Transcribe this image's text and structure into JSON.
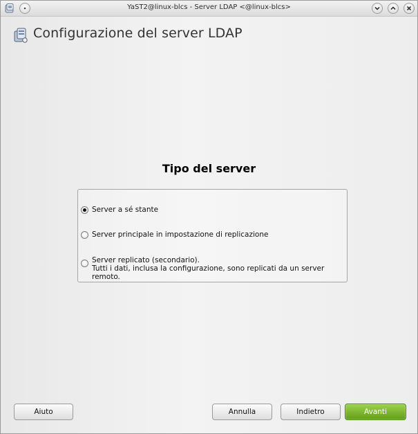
{
  "window": {
    "title": "YaST2@linux-blcs - Server LDAP <@linux-blcs>"
  },
  "header": {
    "title": "Configurazione del server LDAP",
    "icon": "ldap-server-icon"
  },
  "section": {
    "title": "Tipo del server",
    "options": [
      {
        "label_lines": [
          "Server a sé stante"
        ],
        "selected": true
      },
      {
        "label_lines": [
          "Server principale in impostazione di replicazione"
        ],
        "selected": false
      },
      {
        "label_lines": [
          "Server replicato (secondario).",
          "Tutti i dati, inclusa la configurazione, sono replicati da un server remoto."
        ],
        "selected": false
      }
    ]
  },
  "buttons": {
    "help": "Aiuto",
    "abort": "Annulla",
    "back": "Indietro",
    "next": "Avanti"
  },
  "colors": {
    "next_button": "#6fae24"
  }
}
